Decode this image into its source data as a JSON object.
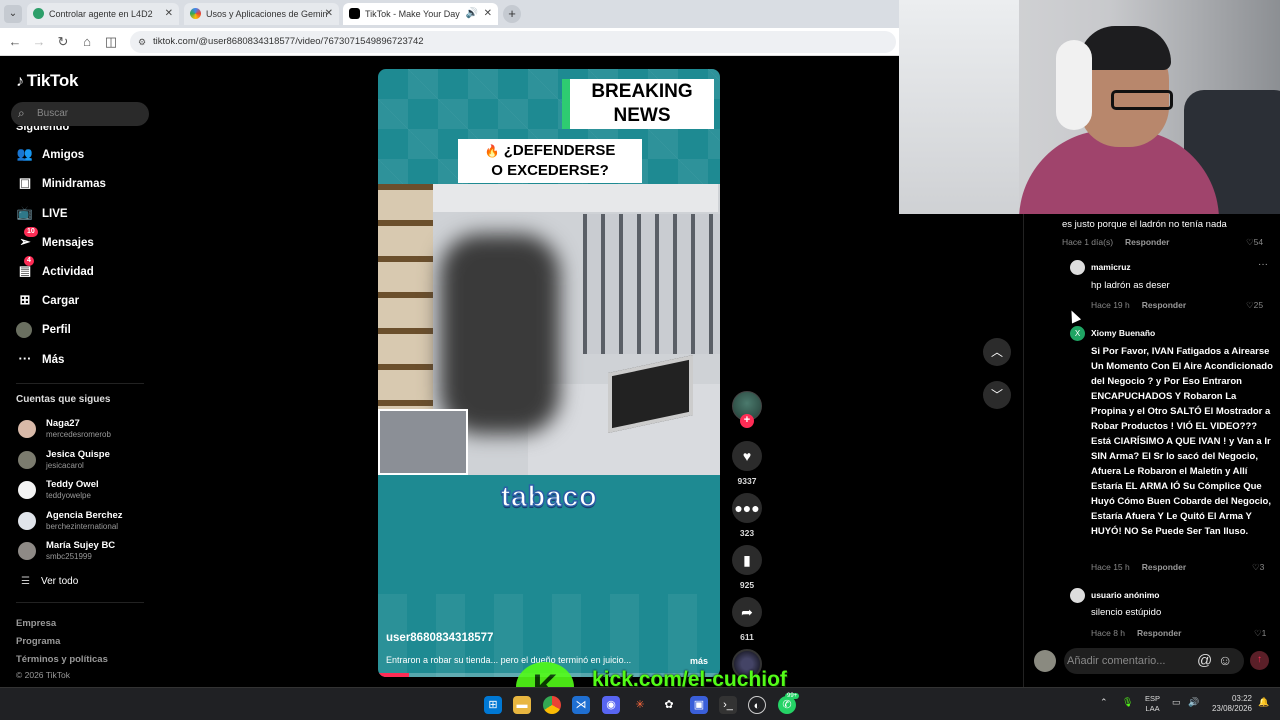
{
  "browser": {
    "tabs": [
      {
        "label": "Controlar agente en L4D2"
      },
      {
        "label": "Usos y Aplicaciones de Gemin"
      },
      {
        "label": "TikTok - Make Your Day"
      }
    ],
    "url": "tiktok.com/@user8680834318577/video/7673071549896723742"
  },
  "sidebar": {
    "logo": "TikTok",
    "search_placeholder": "Buscar",
    "partial_item": "Siguiendo",
    "nav": [
      {
        "label": "Amigos"
      },
      {
        "label": "Minidramas"
      },
      {
        "label": "LIVE"
      },
      {
        "label": "Mensajes",
        "badge": "10"
      },
      {
        "label": "Actividad",
        "badge": "4"
      },
      {
        "label": "Cargar"
      },
      {
        "label": "Perfil"
      },
      {
        "label": "Más"
      }
    ],
    "following_title": "Cuentas que sigues",
    "following": [
      {
        "name": "Naga27",
        "handle": "mercedesromerob"
      },
      {
        "name": "Jesica Quispe",
        "handle": "jesicacarol"
      },
      {
        "name": "Teddy Owel",
        "handle": "teddyowelpe"
      },
      {
        "name": "Agencia Berchez",
        "handle": "berchezinternational"
      },
      {
        "name": "María Sujey BC",
        "handle": "smbc251999"
      }
    ],
    "see_all": "Ver todo",
    "footer": [
      "Empresa",
      "Programa",
      "Términos y políticas"
    ],
    "copyright": "© 2026 TikTok"
  },
  "video": {
    "banner_line1": "BREAKING",
    "banner_line2": "NEWS",
    "headline_line1": "¿DEFENDERSE",
    "headline_line2": "O EXCEDERSE?",
    "overlay_word": "tabaco",
    "username": "user8680834318577",
    "description": "Entraron a robar su tienda... pero el dueño terminó en juicio...",
    "more": "más",
    "progress": 0.09
  },
  "actions": {
    "likes": "9337",
    "comments": "323",
    "saves": "925",
    "shares": "611"
  },
  "comments_panel": {
    "top_text": "es justo porque el ladrón no tenía nada",
    "top_time": "Hace 1 día(s)",
    "reply_label": "Responder",
    "top_likes": "54",
    "items": [
      {
        "name": "mamicruz",
        "text": "hp ladrón as deser",
        "time": "Hace 19 h",
        "likes": "25"
      },
      {
        "name": "Xiomy Buenaño",
        "text": "Si Por Favor, IVAN Fatigados a Airearse Un Momento Con El Aire Acondicionado del Negocio ? y Por Eso Entraron ENCAPUCHADOS Y Robaron La Propina y el Otro SALTÓ El Mostrador a Robar Productos ! VIÓ EL VIDEO??? Está CIARÍSIMO A QUE IVAN ! y Van a Ir SIN Arma? El Sr lo sacó del Negocio, Afuera Le Robaron el Maletín y Allí Estaría EL ARMA IÓ Su Cómplice Que Huyó Cómo Buen Cobarde del Negocio, Estaría Afuera Y Le Quitó El Arma Y HUYÓ! NO Se Puede Ser Tan Iluso.",
        "time": "Hace 15 h",
        "likes": "3"
      },
      {
        "name": "usuario anónimo",
        "text": "silencio estúpido",
        "time": "Hace 8 h",
        "likes": "1"
      }
    ],
    "input_placeholder": "Añadir comentario..."
  },
  "watermark": {
    "letter": "K",
    "text": "kick.com/el-cuchiof"
  },
  "taskbar": {
    "lang_line1": "ESP",
    "lang_line2": "LAA",
    "time": "03:22",
    "date": "23/08/2026",
    "whatsapp_badge": "99+"
  },
  "colors": {
    "accent": "#fe2c55",
    "video_bg": "#1e8a92",
    "kick_green": "#53fc18"
  }
}
